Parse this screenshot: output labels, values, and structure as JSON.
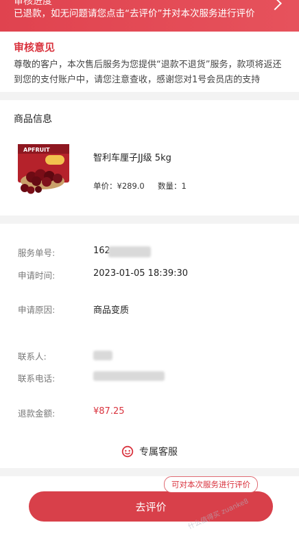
{
  "banner": {
    "title": "审核进度",
    "description": "已退款，如无问题请您点击“去评价”并对本次服务进行评价"
  },
  "review": {
    "title": "审核意见",
    "text": "尊敬的客户，本次售后服务为您提供“退款不退货”服务，款项将返还到您的支付账户中，请您注意查收，感谢您对1号会员店的支持"
  },
  "product": {
    "section_title": "商品信息",
    "name": "智利车厘子JJ级 5kg",
    "price": "单价：¥289.0",
    "quantity": "数量：1",
    "image_text": "APFRUIT"
  },
  "service_info": {
    "order_no_label": "服务单号:",
    "order_no_value": "162",
    "apply_time_label": "申请时间:",
    "apply_time_value": "2023-01-05 18:39:30",
    "reason_label": "申请原因:",
    "reason_value": "商品变质",
    "contact_label": "联系人:",
    "phone_label": "联系电话:",
    "refund_label": "退款金额:",
    "refund_value": "¥87.25"
  },
  "customer_service": {
    "label": "专属客服"
  },
  "action": {
    "button_label": "去评价",
    "tooltip": "可对本次服务进行评价"
  },
  "watermark": {
    "text": "什么值得买 zuanke8"
  },
  "colors": {
    "accent": "#d9323d",
    "banner": "#e34a55"
  }
}
